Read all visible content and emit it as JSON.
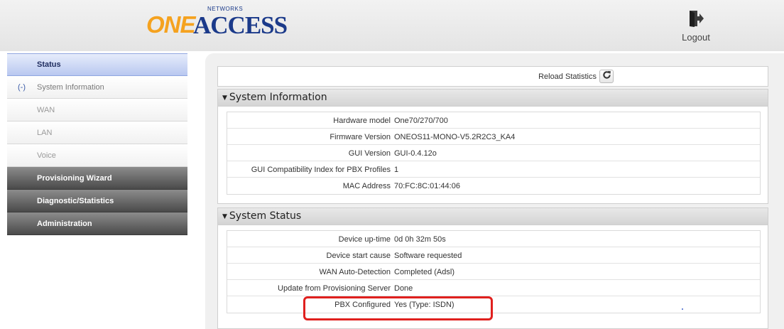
{
  "header": {
    "logo": {
      "one": "ONE",
      "access": "ACCESS",
      "networks": "NETWORKS"
    },
    "logout_label": "Logout"
  },
  "sidebar": {
    "items": [
      {
        "label": "Status",
        "style": "active"
      },
      {
        "label": "System Information",
        "style": "sub-open",
        "toggle": "(-)"
      },
      {
        "label": "WAN",
        "style": "sub"
      },
      {
        "label": "LAN",
        "style": "sub"
      },
      {
        "label": "Voice",
        "style": "sub"
      },
      {
        "label": "Provisioning Wizard",
        "style": "dark"
      },
      {
        "label": "Diagnostic/Statistics",
        "style": "dark"
      },
      {
        "label": "Administration",
        "style": "dark"
      }
    ]
  },
  "main": {
    "reload_label": "Reload Statistics",
    "system_information": {
      "title": "System Information",
      "rows": [
        {
          "label": "Hardware model",
          "value": "One70/270/700"
        },
        {
          "label": "Firmware Version",
          "value": "ONEOS11-MONO-V5.2R2C3_KA4"
        },
        {
          "label": "GUI Version",
          "value": "GUI-0.4.12o"
        },
        {
          "label": "GUI Compatibility Index for PBX Profiles",
          "value": "1"
        },
        {
          "label": "MAC Address",
          "value": "70:FC:8C:01:44:06"
        }
      ]
    },
    "system_status": {
      "title": "System Status",
      "rows": [
        {
          "label": "Device up-time",
          "value": "0d 0h 32m 50s"
        },
        {
          "label": "Device start cause",
          "value": "Software requested"
        },
        {
          "label": "WAN Auto-Detection",
          "value": "Completed (Adsl)"
        },
        {
          "label": "Update from Provisioning Server",
          "value": "Done"
        },
        {
          "label": "PBX Configured",
          "value": "Yes (Type: ISDN)"
        }
      ]
    }
  },
  "colors": {
    "accent_blue": "#1b3a8a",
    "logo_orange": "#f5a21f",
    "highlight_red": "#e0201e"
  }
}
